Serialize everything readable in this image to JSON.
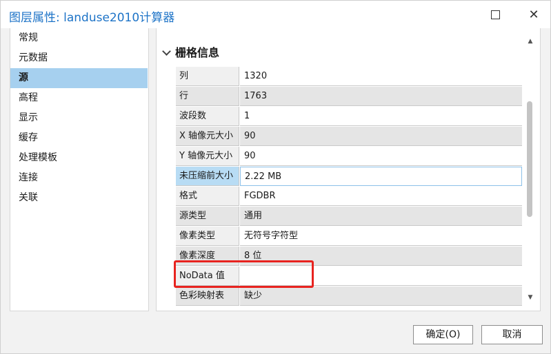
{
  "window": {
    "title": "图层属性: landuse2010计算器",
    "maximize_icon": "square-icon",
    "close_label": "✕"
  },
  "nav": {
    "items": [
      {
        "label": "常规",
        "selected": false
      },
      {
        "label": "元数据",
        "selected": false
      },
      {
        "label": "源",
        "selected": true
      },
      {
        "label": "高程",
        "selected": false
      },
      {
        "label": "显示",
        "selected": false
      },
      {
        "label": "缓存",
        "selected": false
      },
      {
        "label": "处理模板",
        "selected": false
      },
      {
        "label": "连接",
        "selected": false
      },
      {
        "label": "关联",
        "selected": false
      }
    ]
  },
  "section": {
    "title": "栅格信息"
  },
  "properties": [
    {
      "key": "列",
      "value": "1320"
    },
    {
      "key": "行",
      "value": "1763"
    },
    {
      "key": "波段数",
      "value": "1"
    },
    {
      "key": "X 轴像元大小",
      "value": "90"
    },
    {
      "key": "Y 轴像元大小",
      "value": "90"
    },
    {
      "key": "未压缩前大小",
      "value": "2.22 MB"
    },
    {
      "key": "格式",
      "value": "FGDBR"
    },
    {
      "key": "源类型",
      "value": "通用"
    },
    {
      "key": "像素类型",
      "value": "无符号字符型"
    },
    {
      "key": "像素深度",
      "value": "8 位"
    },
    {
      "key": "NoData 值",
      "value": ""
    },
    {
      "key": "色彩映射表",
      "value": "缺少"
    }
  ],
  "buttons": {
    "ok": "确定(O)",
    "cancel": "取消"
  },
  "colors": {
    "title_blue": "#1d73c7",
    "selected_bg": "#a6d0ef",
    "annotation_red": "#e8231f"
  }
}
